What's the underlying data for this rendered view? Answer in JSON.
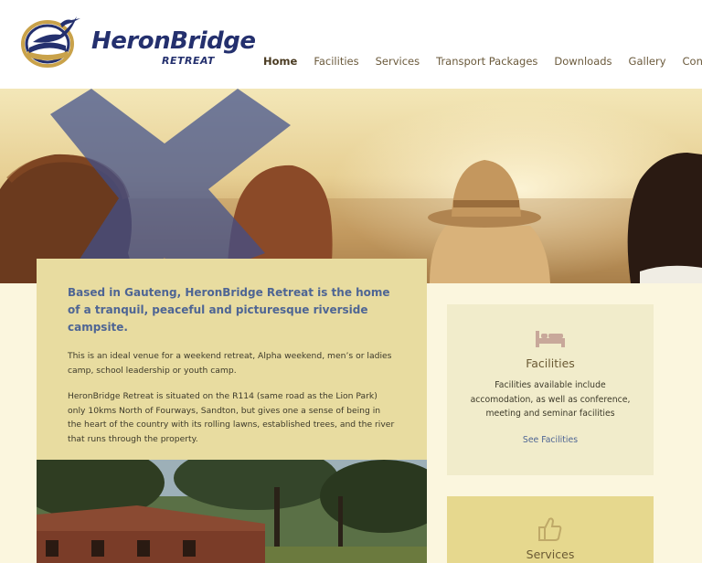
{
  "brand": {
    "name": "HeronBridge",
    "sub": "RETREAT",
    "colors": {
      "navy": "#24306e",
      "gold": "#c9a24a"
    }
  },
  "nav": {
    "items": [
      {
        "label": "Home",
        "active": true
      },
      {
        "label": "Facilities"
      },
      {
        "label": "Services"
      },
      {
        "label": "Transport Packages"
      },
      {
        "label": "Downloads"
      },
      {
        "label": "Gallery"
      },
      {
        "label": "Contact"
      }
    ]
  },
  "intro": {
    "title": "Based in Gauteng, HeronBridge Retreat is the home of a tranquil, peaceful and picturesque riverside campsite.",
    "p1": "This is an ideal venue for a weekend retreat, Alpha weekend, men’s or ladies camp, school leadership or youth camp.",
    "p2": "HeronBridge Retreat is situated on the R114 (same road as the Lion Park) only 10kms North of Fourways, Sandton, but gives one a sense of being in the heart of the country with its rolling lawns, established trees, and the river that runs through the property."
  },
  "cards": {
    "facilities": {
      "icon": "bed-icon",
      "title": "Facilities",
      "desc": "Facilities available include accomodation, as well as conference, meeting and seminar facilities",
      "link": "See Facilities"
    },
    "services": {
      "icon": "thumbs-up-icon",
      "title": "Services"
    }
  }
}
